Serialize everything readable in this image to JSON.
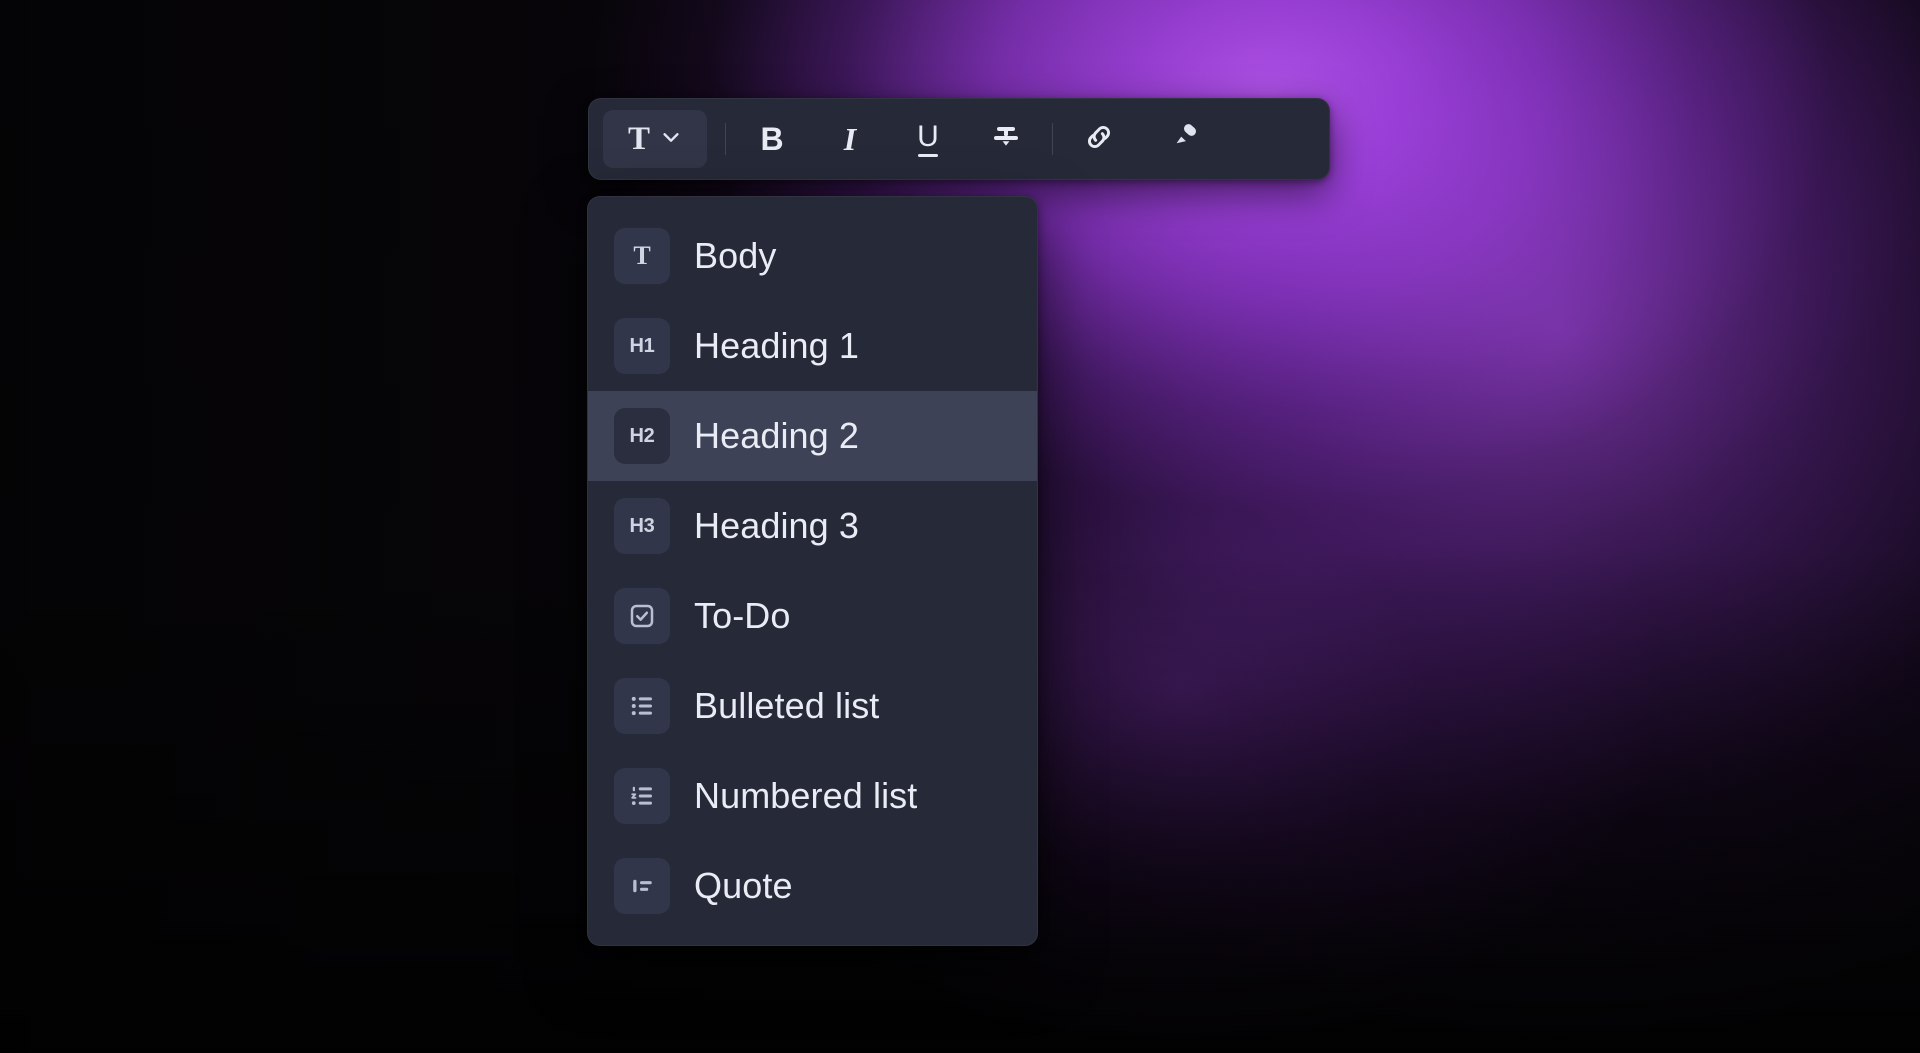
{
  "background": {
    "accent_purple": "#9b3fd9",
    "glow_highlight": "#be5cf5",
    "base_dark": "#070509"
  },
  "toolbar": {
    "name": "text-format-toolbar",
    "surface_color": "#262937",
    "style_selector": {
      "icon": "text-style-T-icon",
      "glyph": "T",
      "chevron": "chevron-down-icon",
      "active": true
    },
    "buttons": [
      {
        "id": "bold",
        "label": "B",
        "icon": "bold-icon",
        "active": false
      },
      {
        "id": "italic",
        "label": "I",
        "icon": "italic-icon",
        "active": false
      },
      {
        "id": "underline",
        "label": "U",
        "icon": "underline-icon",
        "active": false
      },
      {
        "id": "strikethrough",
        "label": "",
        "icon": "strikethrough-icon",
        "active": false
      },
      {
        "id": "link",
        "label": "",
        "icon": "link-icon",
        "active": false
      },
      {
        "id": "highlight",
        "label": "",
        "icon": "highlighter-icon",
        "active": false
      }
    ]
  },
  "style_menu": {
    "name": "text-style-dropdown",
    "surface_color": "#262937",
    "active_row_color": "#3e4256",
    "selected": "Heading 2",
    "items": [
      {
        "label": "Body",
        "chip": "T",
        "icon": "text-body-icon",
        "selected": false
      },
      {
        "label": "Heading 1",
        "chip": "H1",
        "icon": "heading-1-icon",
        "selected": false
      },
      {
        "label": "Heading 2",
        "chip": "H2",
        "icon": "heading-2-icon",
        "selected": true
      },
      {
        "label": "Heading 3",
        "chip": "H3",
        "icon": "heading-3-icon",
        "selected": false
      },
      {
        "label": "To-Do",
        "chip": "",
        "icon": "checkbox-icon",
        "selected": false
      },
      {
        "label": "Bulleted list",
        "chip": "",
        "icon": "bulleted-list-icon",
        "selected": false
      },
      {
        "label": "Numbered list",
        "chip": "",
        "icon": "numbered-list-icon",
        "selected": false
      },
      {
        "label": "Quote",
        "chip": "",
        "icon": "quote-icon",
        "selected": false
      }
    ]
  }
}
